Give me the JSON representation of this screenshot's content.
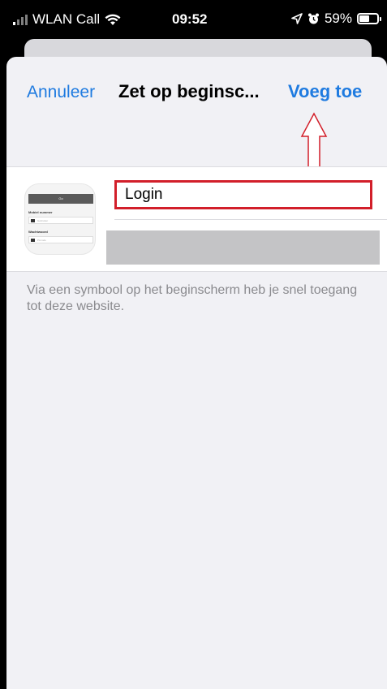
{
  "status_bar": {
    "carrier": "WLAN Call",
    "time": "09:52",
    "battery": "59%",
    "battery_level": 0.59,
    "icons": [
      "signal-icon",
      "wifi-icon",
      "location-icon",
      "alarm-icon",
      "battery-icon"
    ]
  },
  "nav": {
    "cancel_label": "Annuleer",
    "title": "Zet op beginsc...",
    "add_label": "Voeg toe"
  },
  "bookmark": {
    "name_value": "Login",
    "url_value": "",
    "icon_preview": {
      "header": "Go",
      "field1_label": "Mobiel nummer",
      "field1_placeholder": "Gebruiker",
      "field2_label": "Wachtwoord",
      "field2_placeholder": "Pincode"
    }
  },
  "info_text": "Via een symbool op het beginscherm heb je snel toegang tot deze website.",
  "colors": {
    "accent": "#1f7be0",
    "highlight_border": "#d21f2a",
    "sheet_bg": "#f1f1f5"
  }
}
